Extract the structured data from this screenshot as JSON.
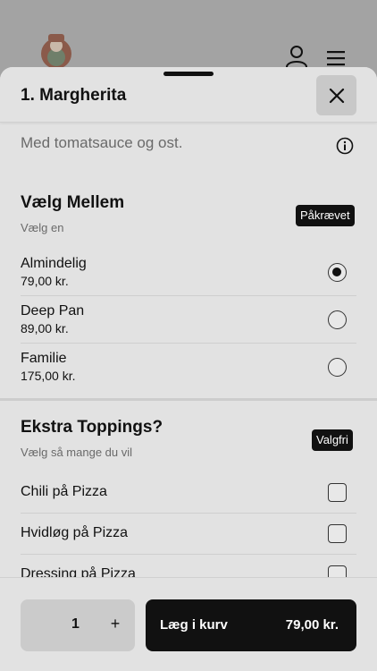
{
  "background": {
    "logo": "pizza-chef-logo",
    "icons": [
      "user-icon",
      "menu-icon"
    ]
  },
  "sheet": {
    "title": "1. Margherita",
    "description": "Med tomatsauce og ost.",
    "size_section": {
      "title": "Vælg Mellem",
      "subtitle": "Vælg en",
      "badge": "Påkrævet",
      "options": [
        {
          "name": "Almindelig",
          "price": "79,00 kr.",
          "selected": true
        },
        {
          "name": "Deep Pan",
          "price": "89,00 kr.",
          "selected": false
        },
        {
          "name": "Familie",
          "price": "175,00 kr.",
          "selected": false
        }
      ]
    },
    "toppings_section": {
      "title": "Ekstra Toppings?",
      "subtitle": "Vælg så mange du vil",
      "badge": "Valgfri",
      "items": [
        {
          "name": "Chili på Pizza",
          "checked": false
        },
        {
          "name": "Hvidløg på Pizza",
          "checked": false
        },
        {
          "name": "Dressing på Pizza",
          "checked": false
        }
      ]
    }
  },
  "footer": {
    "quantity": "1",
    "plus": "+",
    "add_label": "Læg i kurv",
    "add_price": "79,00 kr."
  },
  "colors": {
    "sheet_bg": "#e2e2e2",
    "button_dark": "#111111",
    "qty_bg": "#cbcbcb"
  }
}
